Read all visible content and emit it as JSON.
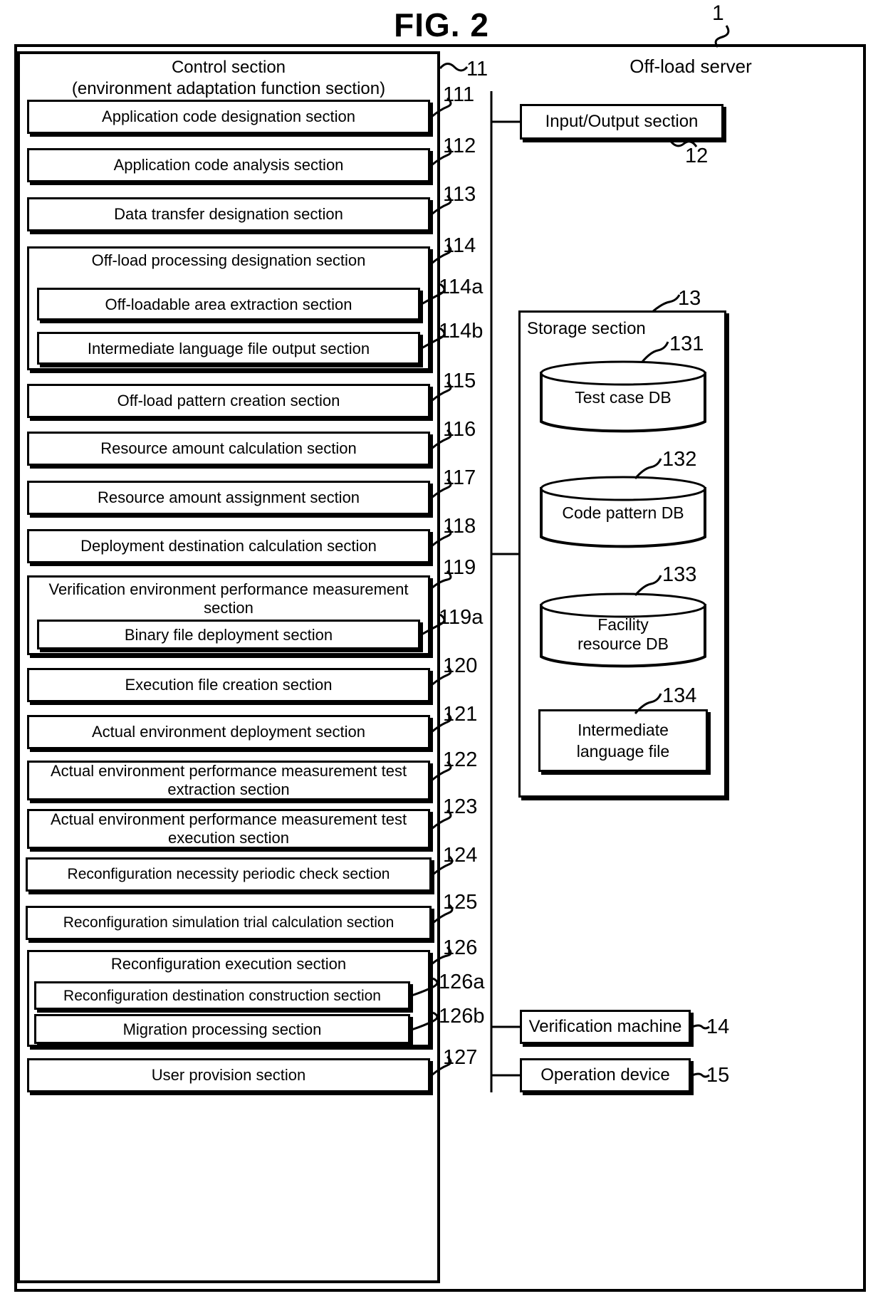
{
  "figure": {
    "title": "FIG. 2",
    "system_ref": "1",
    "server_label": "Off-load server"
  },
  "control_section": {
    "title_line1": "Control section",
    "title_line2": "(environment adaptation function section)",
    "ref": "11",
    "modules": [
      {
        "ref": "111",
        "label": "Application code designation section"
      },
      {
        "ref": "112",
        "label": "Application code analysis section"
      },
      {
        "ref": "113",
        "label": "Data transfer designation section"
      },
      {
        "ref": "114",
        "label": "Off-load processing designation section"
      },
      {
        "ref": "114a",
        "label": "Off-loadable area extraction section"
      },
      {
        "ref": "114b",
        "label": "Intermediate language file output section"
      },
      {
        "ref": "115",
        "label": "Off-load pattern creation section"
      },
      {
        "ref": "116",
        "label": "Resource amount calculation section"
      },
      {
        "ref": "117",
        "label": "Resource amount assignment section"
      },
      {
        "ref": "118",
        "label": "Deployment destination calculation section"
      },
      {
        "ref": "119",
        "label": "Verification environment performance measurement section"
      },
      {
        "ref": "119a",
        "label": "Binary file deployment section"
      },
      {
        "ref": "120",
        "label": "Execution file creation section"
      },
      {
        "ref": "121",
        "label": "Actual environment deployment section"
      },
      {
        "ref": "122",
        "label": "Actual environment performance measurement test extraction section"
      },
      {
        "ref": "123",
        "label": "Actual environment performance measurement test execution section"
      },
      {
        "ref": "124",
        "label": "Reconfiguration necessity periodic check section"
      },
      {
        "ref": "125",
        "label": "Reconfiguration simulation trial calculation section"
      },
      {
        "ref": "126",
        "label": "Reconfiguration execution section"
      },
      {
        "ref": "126a",
        "label": "Reconfiguration destination construction section"
      },
      {
        "ref": "126b",
        "label": "Migration processing section"
      },
      {
        "ref": "127",
        "label": "User provision section"
      }
    ]
  },
  "io_section": {
    "label": "Input/Output section",
    "ref": "12"
  },
  "storage_section": {
    "title": "Storage section",
    "ref": "13",
    "items": [
      {
        "ref": "131",
        "label": "Test case DB",
        "shape": "cylinder"
      },
      {
        "ref": "132",
        "label": "Code pattern DB",
        "shape": "cylinder"
      },
      {
        "ref": "133",
        "label": "Facility\nresource DB",
        "shape": "cylinder"
      },
      {
        "ref": "134",
        "label": "Intermediate\nlanguage file",
        "shape": "rectangle"
      }
    ]
  },
  "peripherals": [
    {
      "label": "Verification machine",
      "ref": "14"
    },
    {
      "label": "Operation device",
      "ref": "15"
    }
  ]
}
